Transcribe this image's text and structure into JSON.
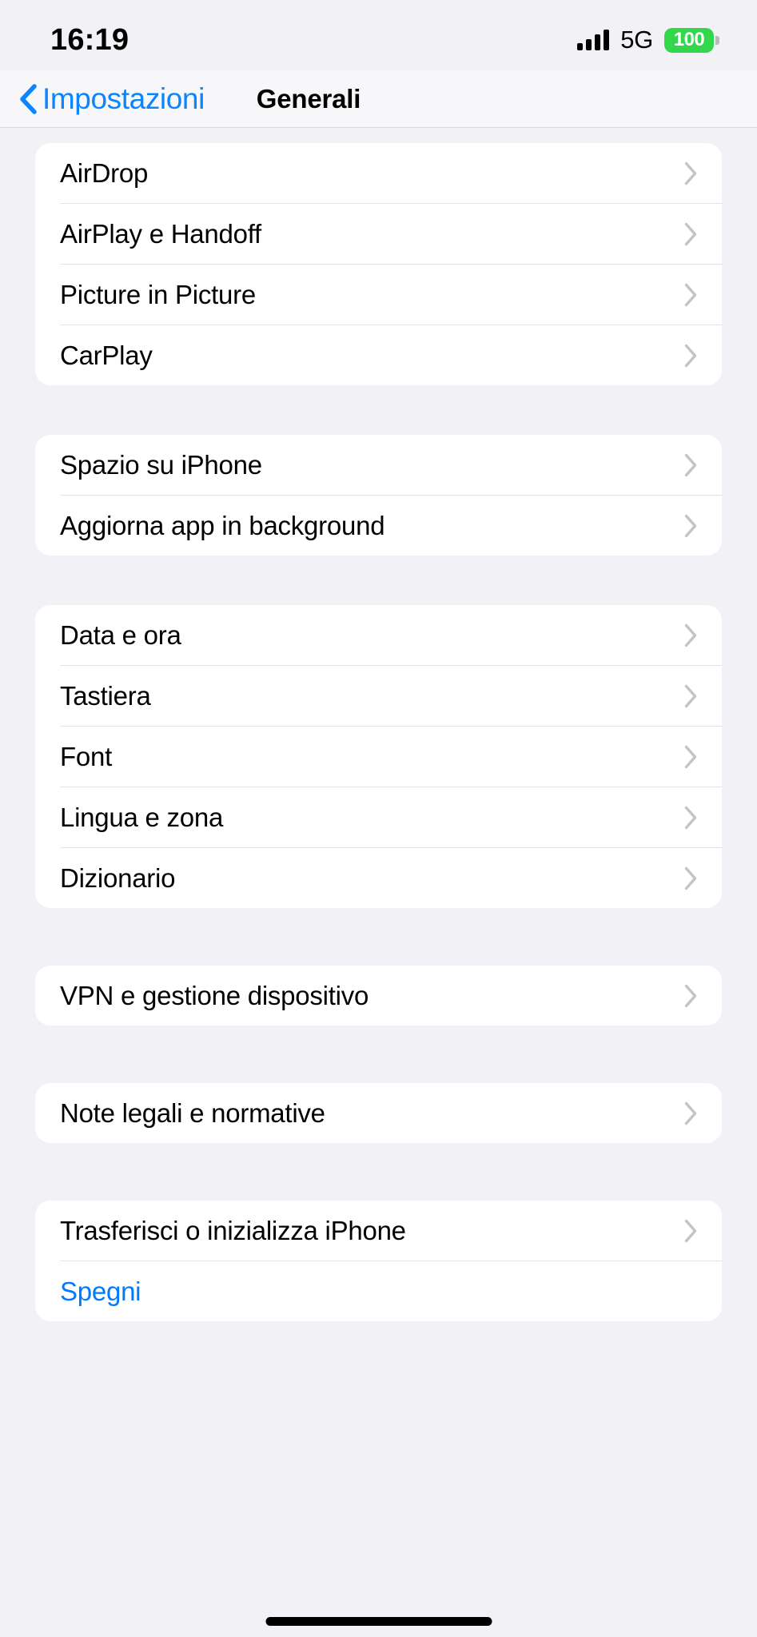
{
  "status_bar": {
    "time": "16:19",
    "network": "5G",
    "battery_percent": "100",
    "battery_color": "#32d74b",
    "signal_icon": "signal-bars-icon"
  },
  "nav": {
    "back_label": "Impostazioni",
    "back_icon": "chevron-left-icon",
    "title": "Generali"
  },
  "accent_color": "#007aff",
  "groups": [
    {
      "rows": [
        {
          "label": "AirDrop",
          "accessory": "chevron-right-icon"
        },
        {
          "label": "AirPlay e Handoff",
          "accessory": "chevron-right-icon"
        },
        {
          "label": "Picture in Picture",
          "accessory": "chevron-right-icon"
        },
        {
          "label": "CarPlay",
          "accessory": "chevron-right-icon"
        }
      ]
    },
    {
      "rows": [
        {
          "label": "Spazio su iPhone",
          "accessory": "chevron-right-icon"
        },
        {
          "label": "Aggiorna app in background",
          "accessory": "chevron-right-icon"
        }
      ]
    },
    {
      "rows": [
        {
          "label": "Data e ora",
          "accessory": "chevron-right-icon"
        },
        {
          "label": "Tastiera",
          "accessory": "chevron-right-icon"
        },
        {
          "label": "Font",
          "accessory": "chevron-right-icon"
        },
        {
          "label": "Lingua e zona",
          "accessory": "chevron-right-icon"
        },
        {
          "label": "Dizionario",
          "accessory": "chevron-right-icon"
        }
      ]
    },
    {
      "rows": [
        {
          "label": "VPN e gestione dispositivo",
          "accessory": "chevron-right-icon"
        }
      ]
    },
    {
      "rows": [
        {
          "label": "Note legali e normative",
          "accessory": "chevron-right-icon"
        }
      ]
    },
    {
      "rows": [
        {
          "label": "Trasferisci o inizializza iPhone",
          "accessory": "chevron-right-icon"
        },
        {
          "label": "Spegni",
          "accessory": "none",
          "style": "accent"
        }
      ]
    }
  ]
}
